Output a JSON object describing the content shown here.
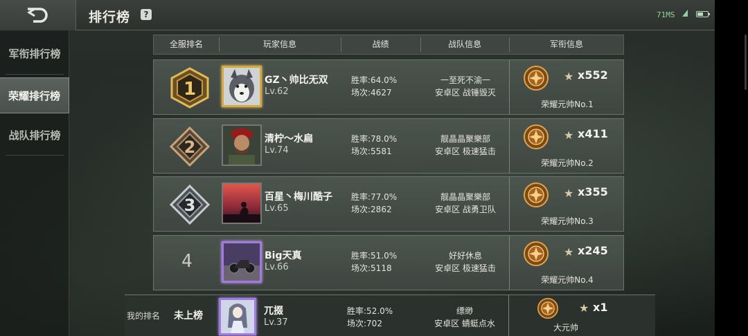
{
  "header": {
    "title": "排行榜",
    "help": "?",
    "network": "71MS",
    "battery_level": 0.6
  },
  "sidebar": {
    "items": [
      {
        "label": "军衔排行榜",
        "active": false
      },
      {
        "label": "荣耀排行榜",
        "active": true
      },
      {
        "label": "战队排行榜",
        "active": false
      }
    ]
  },
  "table": {
    "headers": [
      "全服排名",
      "玩家信息",
      "战绩",
      "战队信息",
      "军衔信息"
    ]
  },
  "rows": [
    {
      "rank": "1",
      "name": "GZ丶帅比无双",
      "level": "Lv.62",
      "winrate": "胜率:64.0%",
      "matches": "场次:4627",
      "team_top": "一至死不渝一",
      "team_bottom": "安卓区 战锤毁灭",
      "count": "x552",
      "title": "荣耀元帅No.1"
    },
    {
      "rank": "2",
      "name": "清柠～水扁",
      "level": "Lv.74",
      "winrate": "胜率:78.0%",
      "matches": "场次:5581",
      "team_top": "靓晶晶聚樂部",
      "team_bottom": "安卓区 极速猛击",
      "count": "x411",
      "title": "荣耀元帅No.2"
    },
    {
      "rank": "3",
      "name": "百星丶梅川酷子",
      "level": "Lv.65",
      "winrate": "胜率:77.0%",
      "matches": "场次:2862",
      "team_top": "靓晶晶聚樂部",
      "team_bottom": "安卓区 战勇卫队",
      "count": "x355",
      "title": "荣耀元帅No.3"
    },
    {
      "rank": "4",
      "name": "Big天真",
      "level": "Lv.66",
      "winrate": "胜率:51.0%",
      "matches": "场次:5118",
      "team_top": "好好休息",
      "team_bottom": "安卓区 极速猛击",
      "count": "x245",
      "title": "荣耀元帅No.4"
    }
  ],
  "my_rank": {
    "label": "我的排名",
    "rank": "未上榜",
    "name": "兀掇",
    "level": "Lv.37",
    "winrate": "胜率:52.0%",
    "matches": "场次:702",
    "team_top": "缥缈",
    "team_bottom": "安卓区 蜻蜓点水",
    "count": "x1",
    "title": "大元帅"
  },
  "colors": {
    "gold": "#d8a943",
    "purple": "#a27be0",
    "accent_green": "#8fd39b"
  }
}
